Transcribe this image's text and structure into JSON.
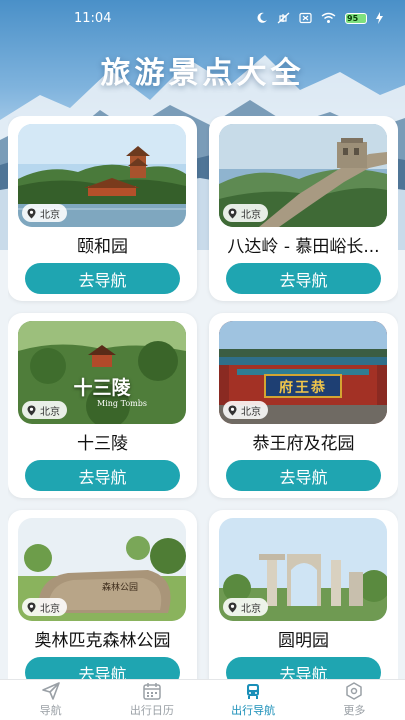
{
  "status": {
    "time": "11:04",
    "battery": "95",
    "icons": [
      "moon-icon",
      "mute-icon",
      "sim-off-icon",
      "wifi-icon",
      "battery-icon",
      "charging-icon"
    ]
  },
  "header": {
    "title": "旅游景点大全"
  },
  "colors": {
    "accent": "#1fa5b1",
    "tab_active": "#1a8fb8",
    "tab_inactive": "#9aa0a6"
  },
  "attractions": [
    {
      "name": "颐和园",
      "location": "北京",
      "button": "去导航"
    },
    {
      "name": "八达岭 - 慕田峪长...",
      "location": "北京",
      "button": "去导航"
    },
    {
      "name": "十三陵",
      "location": "北京",
      "button": "去导航",
      "photo_text": "十三陵",
      "photo_subtext": "Ming Tombs"
    },
    {
      "name": "恭王府及花园",
      "location": "北京",
      "button": "去导航",
      "photo_text": "府王恭"
    },
    {
      "name": "奥林匹克森林公园",
      "location": "北京",
      "button": "去导航",
      "photo_text": "森林公园"
    },
    {
      "name": "圆明园",
      "location": "北京",
      "button": "去导航"
    }
  ],
  "tabs": [
    {
      "label": "导航",
      "icon": "paper-plane-icon",
      "active": false
    },
    {
      "label": "出行日历",
      "icon": "calendar-icon",
      "active": false
    },
    {
      "label": "出行导航",
      "icon": "bus-icon",
      "active": true
    },
    {
      "label": "更多",
      "icon": "hexagon-settings-icon",
      "active": false
    }
  ]
}
